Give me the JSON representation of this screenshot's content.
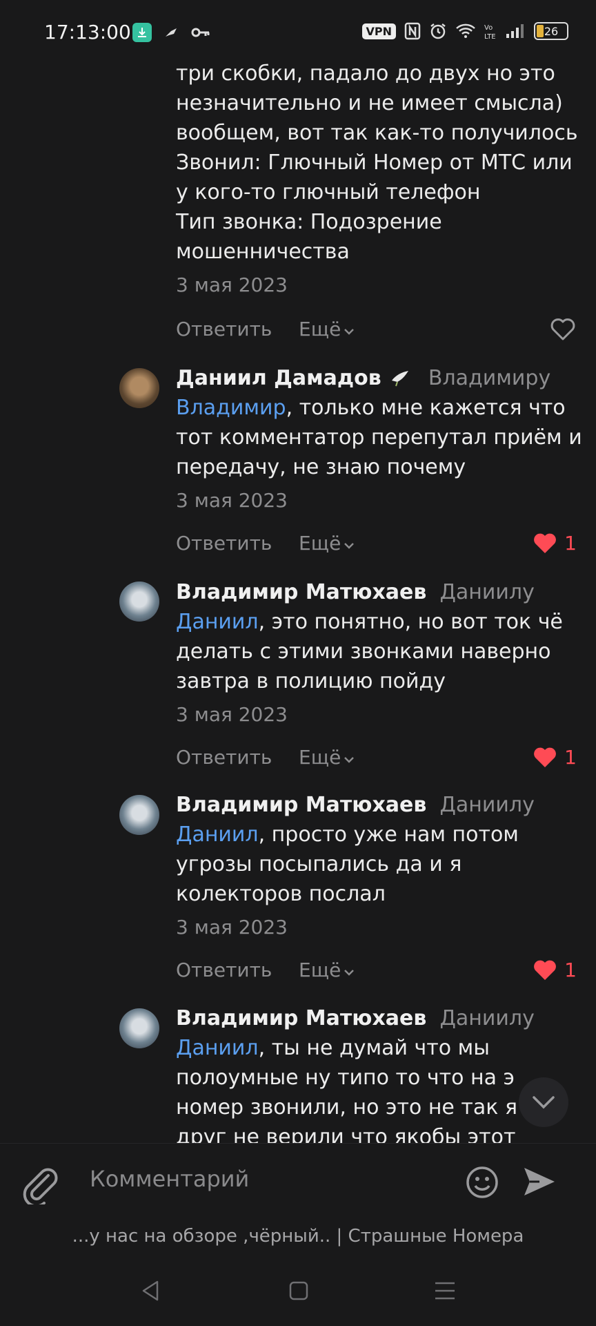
{
  "status_bar": {
    "time": "17:13:00",
    "vpn": "VPN",
    "battery": "26"
  },
  "comments": [
    {
      "text_lines": [
        "три скобки, падало до двух но это",
        "незначительно и не имеет смысла)",
        "вообщем, вот так как-то получилось",
        "Звонил: Глючный Номер от МТС или",
        "у кого-то глючный телефон",
        "Тип звонка: Подозрение",
        "мошенничества"
      ],
      "date": "3 мая 2023",
      "reply_label": "Ответить",
      "more_label": "Ещё"
    },
    {
      "author": "Даниил Дамадов",
      "reply_to": "Владимиру",
      "mention": "Владимир",
      "text_first": ", только мне кажется что",
      "text_rest": [
        "тот комментатор перепутал приём и",
        "передачу, не знаю почему"
      ],
      "date": "3 мая 2023",
      "reply_label": "Ответить",
      "more_label": "Ещё",
      "likes": "1"
    },
    {
      "author": "Владимир Матюхаев",
      "reply_to": "Даниилу",
      "mention": "Даниил",
      "text_first": ", это понятно, но вот ток чё",
      "text_rest": [
        "делать с этими звонками наверно",
        "завтра в полицию пойду"
      ],
      "date": "3 мая 2023",
      "reply_label": "Ответить",
      "more_label": "Ещё",
      "likes": "1"
    },
    {
      "author": "Владимир Матюхаев",
      "reply_to": "Даниилу",
      "mention": "Даниил",
      "text_first": ", просто уже нам потом",
      "text_rest": [
        "угрозы посыпались да и я",
        "колекторов послал"
      ],
      "date": "3 мая 2023",
      "reply_label": "Ответить",
      "more_label": "Ещё",
      "likes": "1"
    },
    {
      "author": "Владимир Матюхаев",
      "reply_to": "Даниилу",
      "mention": "Даниил",
      "text_first": ", ты не думай что мы",
      "text_rest": [
        "полоумные ну типо то что на э",
        "номер звонили, но это не так я",
        "друг не верили что якобы этот"
      ]
    }
  ],
  "composer": {
    "placeholder": "Комментарий"
  },
  "video_caption": "...у нас на обзоре ,чёрный.. | Страшные Номера",
  "colors": {
    "background": "#19191a",
    "mention": "#5b9ff0",
    "like": "#ff4b55",
    "muted": "#8d8d8f"
  }
}
